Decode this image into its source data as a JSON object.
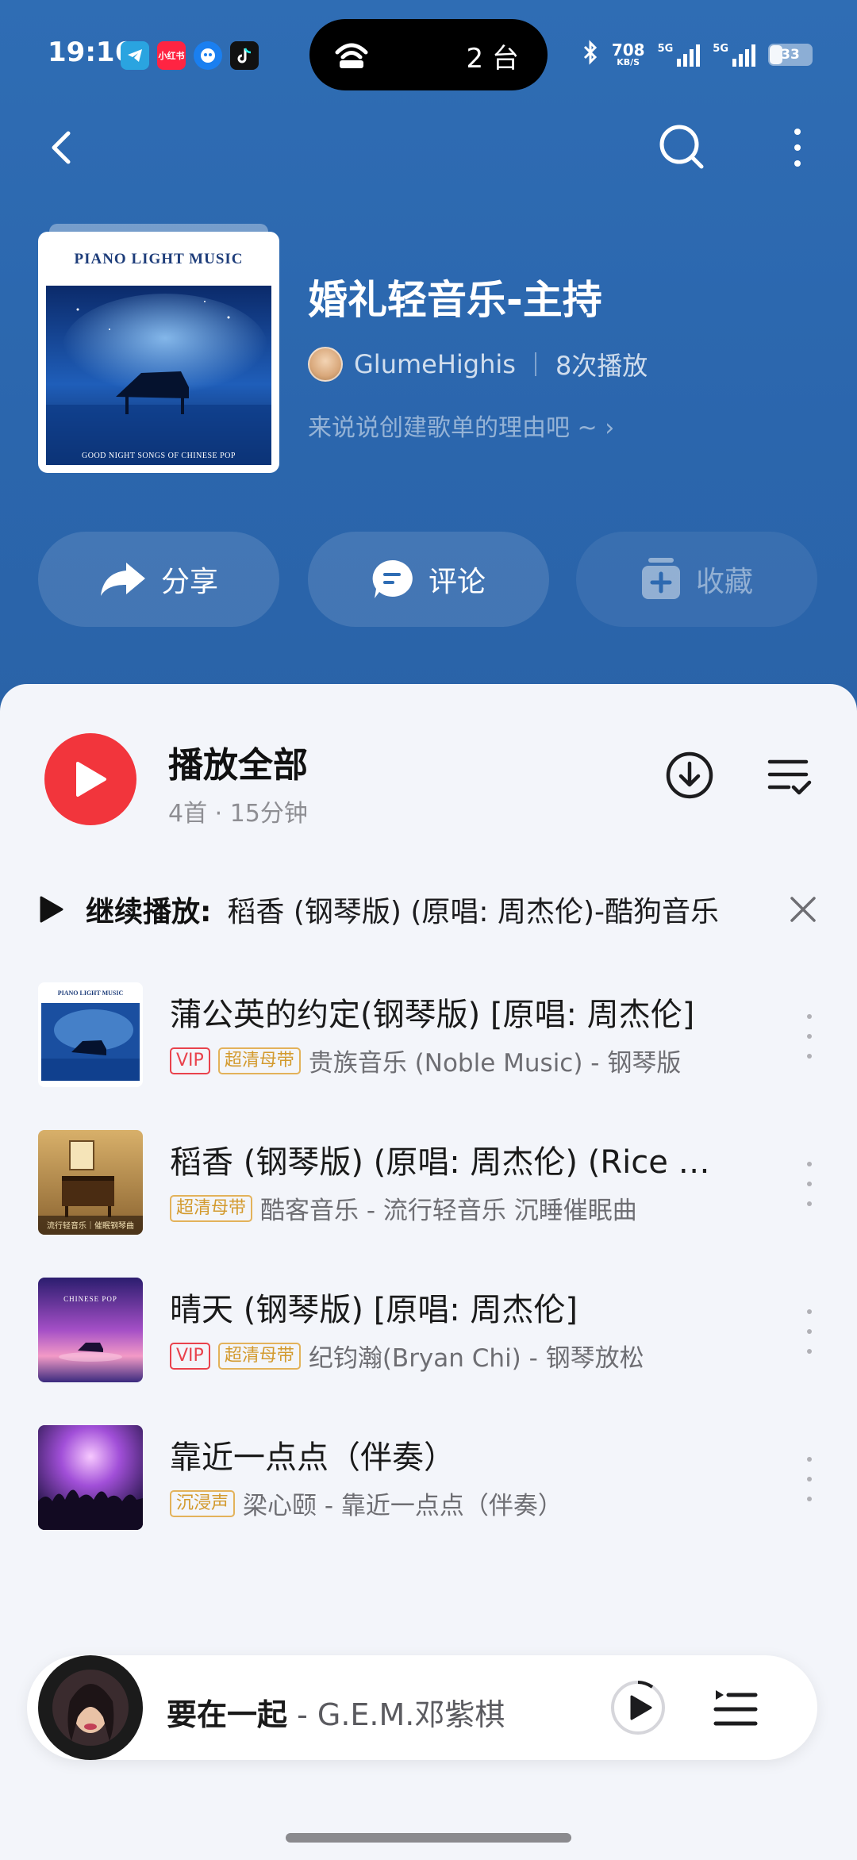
{
  "status_bar": {
    "time": "19:16",
    "apps": [
      {
        "name": "telegram-icon",
        "color": "#2aa4e0",
        "label": ""
      },
      {
        "name": "xiaohongshu-icon",
        "color": "#ff2442",
        "label": "小红书"
      },
      {
        "name": "assistant-icon",
        "color": "#1a7ff0",
        "label": ""
      },
      {
        "name": "tiktok-icon",
        "color": "#111111",
        "label": ""
      }
    ],
    "island_text": "2 台",
    "net_speed_value": "708",
    "net_speed_unit": "KB/S",
    "signal1_label": "5G",
    "signal2_label": "5G",
    "battery": "33"
  },
  "playlist": {
    "cover_title": "PIANO LIGHT MUSIC",
    "cover_subtitle": "GOOD NIGHT SONGS OF CHINESE POP",
    "title": "婚礼轻音乐-主持",
    "creator": "GlumeHighis",
    "play_count": "8次播放",
    "description": "来说说创建歌单的理由吧 ~ ›"
  },
  "actions": {
    "share": "分享",
    "comment": "评论",
    "collect": "收藏"
  },
  "play_all": {
    "title": "播放全部",
    "meta": "4首 · 15分钟"
  },
  "continue": {
    "label": "继续播放:",
    "song": "稻香 (钢琴版) (原唱: 周杰伦)-酷狗音乐"
  },
  "songs": [
    {
      "title": "蒲公英的约定(钢琴版) [原唱: 周杰伦]",
      "badges": [
        "VIP",
        "超清母带"
      ],
      "artist": "贵族音乐 (Noble Music) - 钢琴版",
      "thumb_caption": "PIANO LIGHT MUSIC"
    },
    {
      "title": "稻香 (钢琴版) (原唱: 周杰伦) (Rice Field)",
      "badges": [
        "超清母带"
      ],
      "artist": "酷客音乐 - 流行轻音乐 沉睡催眠曲",
      "thumb_caption": "流行轻音乐｜催眠钢琴曲"
    },
    {
      "title": "晴天 (钢琴版) [原唱: 周杰伦]",
      "badges": [
        "VIP",
        "超清母带"
      ],
      "artist": "纪钧瀚(Bryan Chi) - 钢琴放松",
      "thumb_caption": "CHINESE POP"
    },
    {
      "title": "靠近一点点（伴奏）",
      "badges": [
        "沉浸声"
      ],
      "artist": "梁心颐 - 靠近一点点（伴奏）",
      "thumb_caption": ""
    }
  ],
  "mini_player": {
    "song": "要在一起",
    "artist": " - G.E.M.邓紫棋"
  },
  "colors": {
    "header_blue": "#2f6db4",
    "accent_red": "#f2353c",
    "badge_gold": "#d39a2e"
  }
}
